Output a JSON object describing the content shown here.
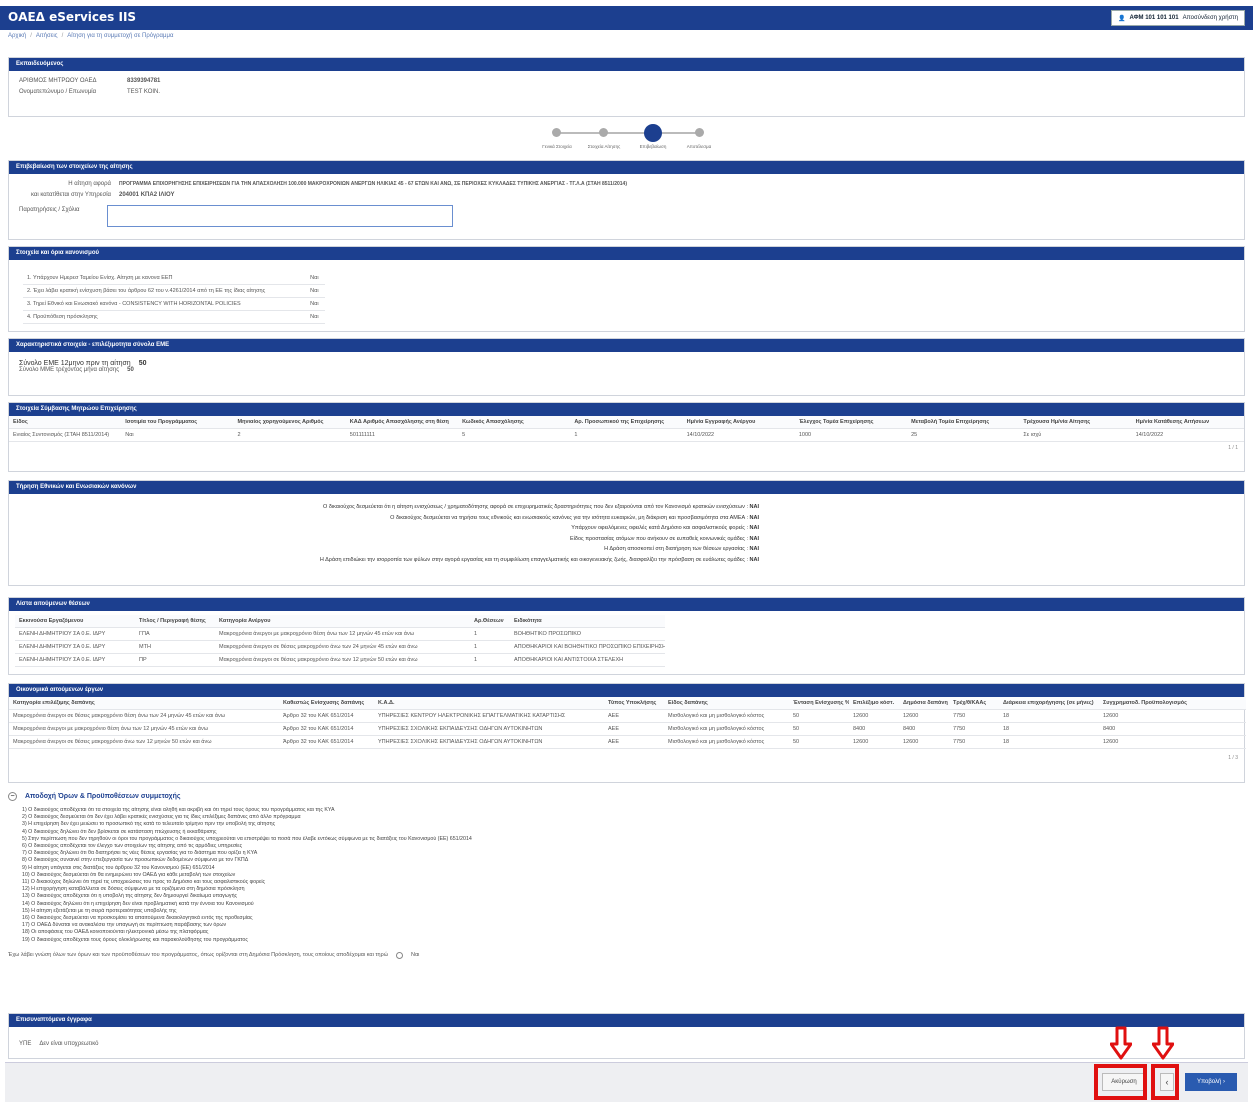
{
  "app": {
    "brand": "ΟΑΕΔ eServices IIS",
    "user_label": "ΑΦΜ 101 101 101",
    "user_menu": "Αποσύνδεση χρήστη"
  },
  "breadcrumb": [
    "Αρχική",
    "Αιτήσεις",
    "Αίτηση για τη συμμετοχή σε Πρόγραμμα"
  ],
  "employer": {
    "title": "Εκπαιδευόμενος",
    "rows": [
      {
        "label": "ΑΡΙΘΜΟΣ ΜΗΤΡΩΟΥ ΟΑΕΔ",
        "value": "8339394781"
      },
      {
        "label": "Ονοματεπώνυμο / Επωνυμία",
        "value": "TEST ΚΟΙΝ."
      }
    ]
  },
  "steps": [
    "Γενικά Στοιχεία",
    "Στοιχεία Αίτησης",
    "Επιβεβαίωση",
    "Αποτέλεσμα"
  ],
  "confirm": {
    "title": "Επιβεβαίωση των στοιχείων της αίτησης",
    "rows": [
      {
        "label": "Η αίτηση αφορά",
        "value": "ΠΡΟΓΡΑΜΜΑ ΕΠΙΧΟΡΗΓΗΣΗΣ ΕΠΙΧΕΙΡΗΣΕΩΝ ΓΙΑ ΤΗΝ ΑΠΑΣΧΟΛΗΣΗ 100.000 ΜΑΚΡΟΧΡΟΝΙΩΝ ΑΝΕΡΓΩΝ ΗΛΙΚΙΑΣ 45 - 67 ΕΤΩΝ ΚΑΙ ΑΝΩ, ΣΕ ΠΕΡΙΟΧΕΣ ΚΥΚΛΑΔΕΣ ΤΥΠΙΚΗΣ ΑΝΕΡΓΙΑΣ - ΤΓ.Λ.Α (ΣΤΑΗ 8511/2014)"
      },
      {
        "label": "και κατατίθεται στην Υπηρεσία",
        "value": "204001 ΚΠΑ2 ΙΛΙΟΥ"
      }
    ],
    "notes_label": "Παρατηρήσεις / Σχόλια",
    "notes_value": ""
  },
  "deminimis": {
    "title": "Στοιχεία και όρια κανονισμού",
    "rows": [
      {
        "text": "1. Υπάρχουν Ημερεσ Ταμείου Ενίσχ. Αίτηση με κανονα ΕΕΠ",
        "v": "Ναι"
      },
      {
        "text": "2. Έχει λάβει κρατική ενίσχυση βάσει του άρθρου 62 του ν.4261/2014 από τη ΕΕ της ίδιας αίτησης",
        "v": "Ναι"
      },
      {
        "text": "3. Τηρεί Εθνικό και Ενωσιακό κανόνα - CONSISTENCY WITH HORIZONTAL POLICIES",
        "v": "Ναι"
      },
      {
        "text": "4. Προϋπόθεση πρόσκλησης",
        "v": "Ναι"
      }
    ]
  },
  "sme": {
    "title": "Χαρακτηριστικά στοιχεία - επιλέξιμοτητα σύνολα ΕΜΕ",
    "rows": [
      {
        "label": "Σύνολο ΕΜΕ 12μηνο πριν τη αίτηση",
        "value": "50"
      },
      {
        "label": "Σύνολο ΜΜΕ τρέχοντος μήνα αίτησης",
        "value": "50"
      }
    ]
  },
  "enterprise": {
    "title": "Στοιχεία Σύμβασης Μητρώου Επιχείρησης",
    "headers": [
      "Είδος",
      "Ισοτιμία του Προγράμματος",
      "Μηνιαίος χορηγούμενος Αριθμός",
      "ΚΑΔ Αριθμός Απασχόλησης στη θέση",
      "Κωδικός Απασχόλησης",
      "Αρ. Προσωπικού της Επιχείρησης",
      "Ημ/νία Εγγραφής Ανέργου",
      "Έλεγχος Τομέα Επιχείρησης",
      "Μεταβολή Τομέα Επιχείρησης",
      "Τρέχουσα Ημ/νία Αίτησης",
      "Ημ/νία Κατάθεσης Αιτήσεων"
    ],
    "row": [
      "Ενιαίος Συντονισμός (ΣΤΑΗ 8511/2014)",
      "Ναι",
      "2",
      "501111111",
      "5",
      "1",
      "14/10/2022",
      "1000",
      "25",
      "Σε ισχύ",
      "14/10/2022"
    ],
    "pager": "1 / 1"
  },
  "declarations": {
    "title": "Τήρηση Εθνικών και Ενωσιακών κανόνων",
    "lines": [
      {
        "text": "Ο δικαιούχος δεσμεύεται ότι η αίτηση ενισχύσεως / χρηματοδότησης αφορά σε επιχειρηματικές δραστηριότητες που δεν εξαιρούνται από τον Κανονισμό κρατικών ενισχύσεων",
        "v": "ΝΑΙ"
      },
      {
        "text": "Ο δικαιούχος δεσμεύεται να τηρήσει τους εθνικούς και ενωσιακούς κανόνες για την ισότητα ευκαιριών, μη διάκριση και προσβασιμότητα στα ΑΜΕΑ",
        "v": "ΝΑΙ"
      },
      {
        "text": "Υπάρχουν οφειλόμενες οφειλές κατά Δημόσιο και ασφαλιστικούς φορείς",
        "v": "ΝΑΙ"
      },
      {
        "text": "Είδος προστασίας ατόμων που ανήκουν σε ευπαθείς κοινωνικές ομάδες",
        "v": "ΝΑΙ"
      },
      {
        "text": "Η Δράση αποσκοπεί στη διατήρηση των θέσεων εργασίας",
        "v": "ΝΑΙ"
      },
      {
        "text": "Η Δράση επιδιώκει την ισορροπία των φύλων στην αγορά εργασίας και τη συμφιλίωση επαγγελματικής και οικογενειακής ζωής, διασφαλίζει την πρόσβαση σε ευάλωτες ομάδες",
        "v": "ΝΑΙ"
      }
    ]
  },
  "positions": {
    "title": "Λίστα αιτούμενων θέσεων",
    "headers": [
      "Εκκινούσα Εργαζόμενου",
      "Τίτλος / Περιγραφή θέσης",
      "Κατηγορία Ανέργου",
      "Αρ.Θέσεων",
      "Ειδικότητα"
    ],
    "rows": [
      [
        "ΕΛΕΝΗ ΔΗΜΗΤΡΙΟΥ ΣΑ 0.Ε. ΙΔΡΥ",
        "ΓΠΑ",
        "Μακροχρόνια άνεργοι με μακροχρόνιο θέση άνω των 12 μηνών 45 ετών και άνω",
        "1",
        "ΒΟΗΘΗΤΙΚΟ ΠΡΟΣΩΠΙΚΟ"
      ],
      [
        "ΕΛΕΝΗ ΔΗΜΗΤΡΙΟΥ ΣΑ 0.Ε. ΙΔΡΥ",
        "ΜΤΗ",
        "Μακροχρόνια άνεργοι σε θέσεις μακροχρόνιο άνω των 24 μηνών 45 ετών και άνω",
        "1",
        "ΑΠΟΘΗΚΑΡΙΟΙ ΚΑΙ ΒΟΗΘΗΤΙΚΟ ΠΡΟΣΩΠΙΚΟ ΕΠΙΧΕΙΡΗΣΗΣ"
      ],
      [
        "ΕΛΕΝΗ ΔΗΜΗΤΡΙΟΥ ΣΑ 0.Ε. ΙΔΡΥ",
        "ΠΡ",
        "Μακροχρόνια άνεργοι σε θέσεις μακροχρόνιο άνω των 12 μηνών 50 ετών και άνω",
        "1",
        "ΑΠΟΘΗΚΑΡΙΟΙ ΚΑΙ ΑΝΤΙΣΤΟΙΧΑ ΣΤΕΛΕΧΗ"
      ]
    ]
  },
  "summary": {
    "title": "Οικονομικά αιτούμενων έργων",
    "headers": [
      "Κατηγορία επιλέξιμης δαπάνης",
      "Καθεστώς Ενίσχυσης δαπάνης",
      "Κ.Α.Δ.",
      "Τύπος Υποκλήσης",
      "Είδος δαπάνης",
      "Ένταση Ενίσχυσης %",
      "Επιλέξιμο κόστ.",
      "Δημόσια δαπάνη",
      "Τρέχ/θ/ΚΑΑς",
      "Διάρκεια επιχορήγησης (σε μήνες)",
      "Συγχρηματοδ. Προϋπολογισμός"
    ],
    "rows": [
      [
        "Μακροχρόνια άνεργοι σε θέσεις μακροχρόνιο θέση άνω των 24 μηνών 45 ετών και άνω",
        "Άρθρο 32 του ΚΑΚ 651/2014",
        "ΥΠΗΡΕΣΙΕΣ ΚΕΝΤΡΟΥ ΗΛΕΚΤΡΟΝΙΚΗΣ ΕΠΑΓΓΕΛΜΑΤΙΚΗΣ ΚΑΤΑΡΤΙΣΗΣ",
        "ΑΕΕ",
        "Μισθολογικό και μη μισθολογικό κόστος",
        "50",
        "12600",
        "12600",
        "7750",
        "18",
        "12600"
      ],
      [
        "Μακροχρόνια άνεργοι με μακροχρόνιο θέση άνω των 12 μηνών 45 ετών και άνω",
        "Άρθρο 32 του ΚΑΚ 651/2014",
        "ΥΠΗΡΕΣΙΕΣ ΣΧΟΛΙΚΗΣ ΕΚΠΑΙΔΕΥΣΗΣ ΟΔΗΓΩΝ ΑΥΤΟΚΙΝΗΤΩΝ",
        "ΑΕΕ",
        "Μισθολογικό και μη μισθολογικό κόστος",
        "50",
        "8400",
        "8400",
        "7750",
        "18",
        "8400"
      ],
      [
        "Μακροχρόνια άνεργοι σε θέσεις μακροχρόνιο άνω των 12 μηνών 50 ετών και άνω",
        "Άρθρο 32 του ΚΑΚ 651/2014",
        "ΥΠΗΡΕΣΙΕΣ ΣΧΟΛΙΚΗΣ ΕΚΠΑΙΔΕΥΣΗΣ ΟΔΗΓΩΝ ΑΥΤΟΚΙΝΗΤΩΝ",
        "ΑΕΕ",
        "Μισθολογικό και μη μισθολογικό κόστος",
        "50",
        "12600",
        "12600",
        "7750",
        "18",
        "12600"
      ]
    ],
    "pager": "1 / 3"
  },
  "terms": {
    "title": "Αποδοχή Όρων & Προϋποθέσεων συμμετοχής",
    "items": [
      "1) Ο δικαιούχος αποδέχεται ότι τα στοιχεία της αίτησης είναι αληθή και ακριβή και ότι τηρεί τους όρους του προγράμματος και της ΚΥΑ",
      "2) Ο δικαιούχος δεσμεύεται ότι δεν έχει λάβει κρατικές ενισχύσεις για τις ίδιες επιλέξιμες δαπάνες από άλλο πρόγραμμα",
      "3) Η επιχείρηση δεν έχει μειώσει το προσωπικό της κατά το τελευταίο τρίμηνο πριν την υποβολή της αίτησης",
      "4) Ο δικαιούχος δηλώνει ότι δεν βρίσκεται σε κατάσταση πτώχευσης ή εκκαθάρισης",
      "5) Στην περίπτωση που δεν τηρηθούν οι όροι του προγράμματος ο δικαιούχος υποχρεούται να επιστρέψει τα ποσά που έλαβε εντόκως σύμφωνα με τις διατάξεις του Κανονισμού (ΕΕ) 651/2014",
      "6) Ο δικαιούχος αποδέχεται τον έλεγχο των στοιχείων της αίτησης από τις αρμόδιες υπηρεσίες",
      "7) Ο δικαιούχος δηλώνει ότι θα διατηρήσει τις νέες θέσεις εργασίας για το διάστημα που ορίζει η ΚΥΑ",
      "8) Ο δικαιούχος συναινεί στην επεξεργασία των προσωπικών δεδομένων σύμφωνα με τον ΓΚΠΔ",
      "9) Η αίτηση υπάγεται στις διατάξεις του άρθρου 32 του Κανονισμού (ΕΕ) 651/2014",
      "10) Ο δικαιούχος δεσμεύεται ότι θα ενημερώνει τον ΟΑΕΔ για κάθε μεταβολή των στοιχείων",
      "11) Ο δικαιούχος δηλώνει ότι τηρεί τις υποχρεώσεις του προς το Δημόσιο και τους ασφαλιστικούς φορείς",
      "12) Η επιχορήγηση καταβάλλεται σε δόσεις σύμφωνα με τα οριζόμενα στη δημόσια πρόσκληση",
      "13) Ο δικαιούχος αποδέχεται ότι η υποβολή της αίτησης δεν δημιουργεί δικαίωμα υπαγωγής",
      "14) Ο δικαιούχος δηλώνει ότι η επιχείρηση δεν είναι προβληματική κατά την έννοια του Κανονισμού",
      "15) Η αίτηση εξετάζεται με τη σειρά προτεραιότητας υποβολής της",
      "16) Ο δικαιούχος δεσμεύεται να προσκομίσει τα απαιτούμενα δικαιολογητικά εντός της προθεσμίας",
      "17) Ο ΟΑΕΔ δύναται να ανακαλέσει την υπαγωγή σε περίπτωση παράβασης των όρων",
      "18) Οι αποφάσεις του ΟΑΕΔ κοινοποιούνται ηλεκτρονικά μέσω της πλατφόρμας",
      "19) Ο δικαιούχος αποδέχεται τους όρους ολοκλήρωσης και παρακολούθησης του προγράμματος"
    ],
    "accept_label": "Έχω λάβει γνώση όλων των όρων και των προϋποθέσεων του προγράμματος, όπως ορίζονται στη Δημόσια Πρόσκληση, τους οποίους αποδέχομαι και τηρώ",
    "accept_value": "Ναι"
  },
  "attachments": {
    "title": "Επισυναπτόμενα έγγραφα",
    "label": "ΥΠΕ",
    "value": "Δεν είναι υποχρεωτικό"
  },
  "actions": {
    "cancel": "Ακύρωση",
    "back": "‹",
    "next": "Υποβολή ›"
  }
}
